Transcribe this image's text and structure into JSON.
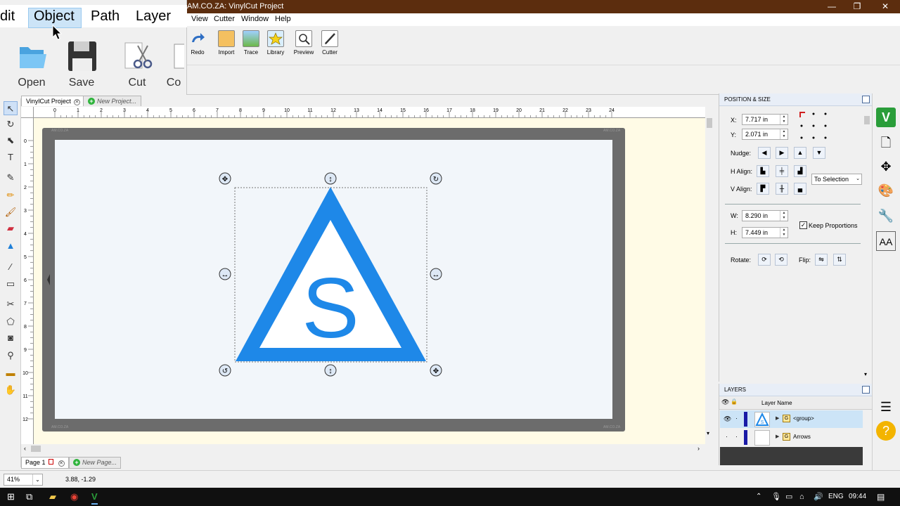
{
  "window": {
    "title": "AM.CO.ZA: VinylCut Project",
    "controls": [
      "—",
      "❐",
      "✕"
    ]
  },
  "menu": [
    "View",
    "Cutter",
    "Window",
    "Help"
  ],
  "toolbar": [
    {
      "label": "Redo",
      "icon": "redo-icon"
    },
    {
      "label": "Import",
      "icon": "import-icon"
    },
    {
      "label": "Trace",
      "icon": "trace-icon"
    },
    {
      "label": "Library",
      "icon": "library-icon"
    },
    {
      "label": "Preview",
      "icon": "preview-icon"
    },
    {
      "label": "Cutter",
      "icon": "cutter-icon"
    }
  ],
  "zoom_overlay": {
    "menu": [
      "dit",
      "Object",
      "Path",
      "Layer"
    ],
    "buttons": [
      "Open",
      "Save",
      "Cut",
      "Co"
    ]
  },
  "doc_tabs": {
    "active": "VinylCut Project",
    "new": "New Project..."
  },
  "ruler": {
    "h_labels": [
      "0",
      "1",
      "2",
      "3",
      "4",
      "5",
      "6",
      "7",
      "8",
      "9",
      "10",
      "11",
      "12",
      "13",
      "14",
      "15",
      "16",
      "17",
      "18",
      "19",
      "20",
      "21",
      "22",
      "23",
      "24"
    ],
    "v_labels": [
      "0",
      "1",
      "2",
      "3",
      "4",
      "5",
      "6",
      "7",
      "8",
      "9",
      "10",
      "11",
      "12"
    ]
  },
  "artwork": {
    "letter": "S",
    "triangle_color": "#1e88e8",
    "mat_label": "AM.CO.ZA"
  },
  "page_tabs": {
    "active": "Page 1",
    "new": "New Page..."
  },
  "status": {
    "zoom": "41%",
    "coords": "3.88, -1.29"
  },
  "position_size": {
    "title": "POSITION & SIZE",
    "x_label": "X:",
    "x": "7.717 in",
    "y_label": "Y:",
    "y": "2.071 in",
    "nudge_label": "Nudge:",
    "halign_label": "H Align:",
    "valign_label": "V Align:",
    "align_to": "To Selection",
    "w_label": "W:",
    "w": "8.290 in",
    "h_label": "H:",
    "h": "7.449 in",
    "keep_proportions": "Keep Proportions",
    "rotate_label": "Rotate:",
    "flip_label": "Flip:"
  },
  "layers": {
    "title": "LAYERS",
    "header": "Layer Name",
    "rows": [
      {
        "name": "<group>",
        "selected": true
      },
      {
        "name": "Arrows",
        "selected": false
      }
    ]
  },
  "taskbar": {
    "lang": "ENG",
    "time": "09:44"
  }
}
